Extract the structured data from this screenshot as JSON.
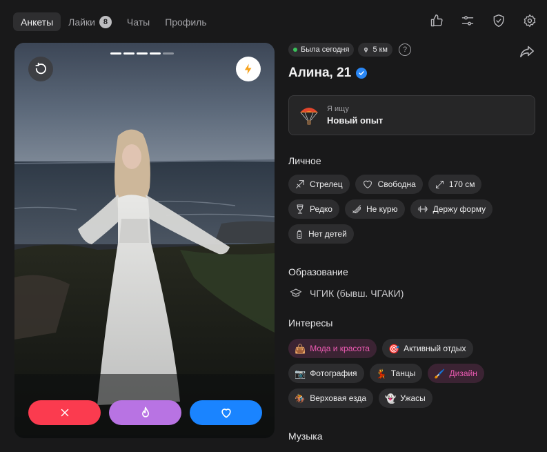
{
  "nav": {
    "tabs": [
      {
        "label": "Анкеты",
        "active": true
      },
      {
        "label": "Лайки",
        "count": "8"
      },
      {
        "label": "Чаты"
      },
      {
        "label": "Профиль"
      }
    ],
    "icons": [
      "thumbs-up-icon",
      "filters-icon",
      "shield-check-icon",
      "settings-gear-icon"
    ]
  },
  "card": {
    "photo_count": 5,
    "current_photo": 4,
    "buttons": [
      "undo",
      "boost",
      "dislike",
      "superlike",
      "like"
    ]
  },
  "profile": {
    "status": "Была сегодня",
    "distance": "5 км",
    "help": "?",
    "name": "Алина, 21",
    "verified": true,
    "looking_label": "Я ищу",
    "looking_value": "Новый опыт"
  },
  "personal": {
    "title": "Личное",
    "items": [
      {
        "icon": "zodiac-arrow-icon",
        "label": "Стрелец"
      },
      {
        "icon": "heart-outline-icon",
        "label": "Свободна"
      },
      {
        "icon": "height-arrows-icon",
        "label": "170 см"
      },
      {
        "icon": "wine-glass-icon",
        "label": "Редко"
      },
      {
        "icon": "no-smoking-icon",
        "label": "Не курю"
      },
      {
        "icon": "dumbbell-icon",
        "label": "Держу форму"
      },
      {
        "icon": "baby-bottle-icon",
        "label": "Нет детей"
      }
    ]
  },
  "education": {
    "title": "Образование",
    "value": "ЧГИК (бывш. ЧГАКИ)"
  },
  "interests": {
    "title": "Интересы",
    "items": [
      {
        "emoji": "👜",
        "label": "Мода и красота",
        "highlight": true
      },
      {
        "emoji": "🎯",
        "label": "Активный отдых",
        "highlight": false
      },
      {
        "emoji": "📷",
        "label": "Фотография",
        "highlight": false
      },
      {
        "emoji": "💃",
        "label": "Танцы",
        "highlight": false
      },
      {
        "emoji": "🖌️",
        "label": "Дизайн",
        "highlight": true
      },
      {
        "emoji": "🏇",
        "label": "Верховая езда",
        "highlight": false
      },
      {
        "emoji": "👻",
        "label": "Ужасы",
        "highlight": false
      }
    ]
  },
  "music": {
    "title": "Музыка"
  },
  "colors": {
    "dislike": "#fb3b4f",
    "superlike": "#b873e3",
    "like": "#1a84ff",
    "highlight_text": "#ed5bb3",
    "online": "#3ac25b"
  }
}
